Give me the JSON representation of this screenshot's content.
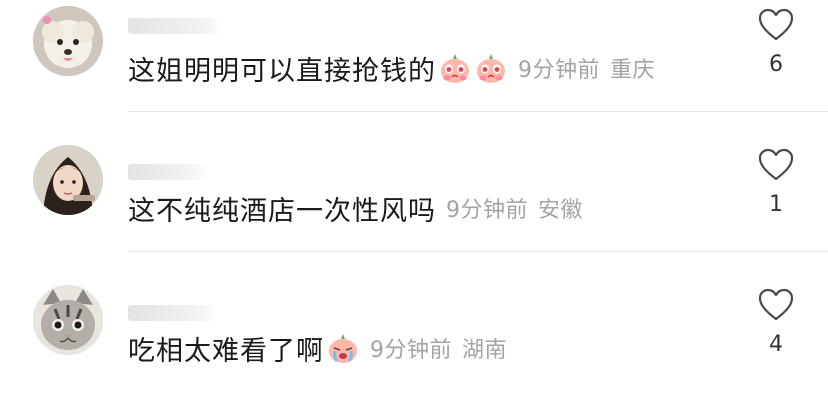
{
  "comments": [
    {
      "text": "这姐明明可以直接抢钱的",
      "emojis": [
        "pleading-peach-emoji",
        "pleading-peach-emoji"
      ],
      "time": "9分钟前",
      "location": "重庆",
      "likes": "6",
      "avatar": "white-dog-avatar"
    },
    {
      "text": "这不纯纯酒店一次性风吗",
      "emojis": [],
      "time": "9分钟前",
      "location": "安徽",
      "likes": "1",
      "avatar": "girl-avatar"
    },
    {
      "text": "吃相太难看了啊",
      "emojis": [
        "crying-peach-emoji"
      ],
      "time": "9分钟前",
      "location": "湖南",
      "likes": "4",
      "avatar": "tabby-cat-avatar"
    }
  ],
  "colors": {
    "text": "#1a1a1a",
    "meta": "#a3a3a3",
    "like_count": "#333333",
    "divider": "#e8e8e8",
    "background": "#ffffff"
  }
}
